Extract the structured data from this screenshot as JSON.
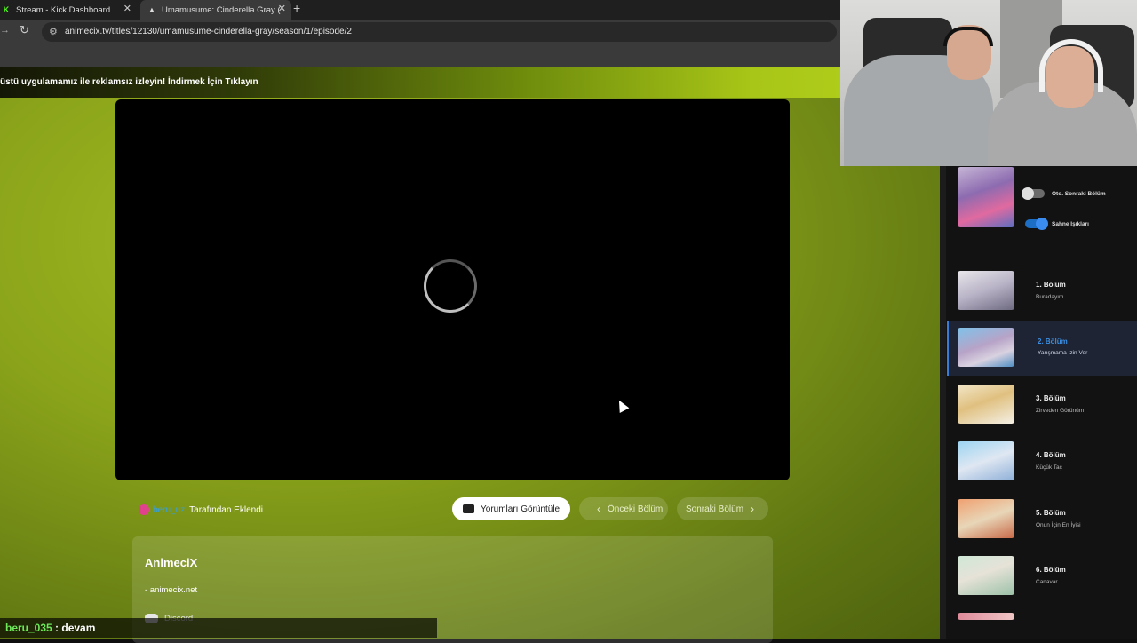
{
  "browser": {
    "tabs": [
      {
        "label": "Stream - Kick Dashboard",
        "icon": "kick-icon"
      },
      {
        "label": "Umamusume: Cinderella Gray (",
        "icon": "animecix-icon"
      }
    ],
    "url": "animecix.tv/titles/12130/umamusume-cinderella-gray/season/1/episode/2"
  },
  "page": {
    "promo_text": "üstü uygulamamız ile reklamsız izleyin! İndirmek İçin Tıklayın",
    "uploader": {
      "name": "beru_uz",
      "suffix": "Tarafından Eklendi"
    },
    "buttons": {
      "comments": "Yorumları Görüntüle",
      "prev": "Önceki Bölüm",
      "next": "Sonraki Bölüm"
    },
    "info": {
      "title": "AnimeciX",
      "link": "- animecix.net",
      "discord": "Discord"
    }
  },
  "chat": {
    "user": "beru_035",
    "separator": " : ",
    "message": "devam"
  },
  "sidebar": {
    "toggles": [
      {
        "label": "Oto. Sonraki Bölüm",
        "on": false
      },
      {
        "label": "Sahne Işıkları",
        "on": true
      }
    ],
    "episodes": [
      {
        "title": "1. Bölüm",
        "subtitle": "Buradayım",
        "active": false
      },
      {
        "title": "2. Bölüm",
        "subtitle": "Yarışmama İzin Ver",
        "active": true
      },
      {
        "title": "3. Bölüm",
        "subtitle": "Zirveden Görünüm",
        "active": false
      },
      {
        "title": "4. Bölüm",
        "subtitle": "Küçük Taç",
        "active": false
      },
      {
        "title": "5. Bölüm",
        "subtitle": "Onun İçin En İyisi",
        "active": false
      },
      {
        "title": "6. Bölüm",
        "subtitle": "Canavar",
        "active": false
      }
    ]
  },
  "colors": {
    "accent_blue": "#3a8de0",
    "page_green": "#8aa31a",
    "chat_user_green": "#6ee85a",
    "uploader_avatar": "#e0438c"
  }
}
